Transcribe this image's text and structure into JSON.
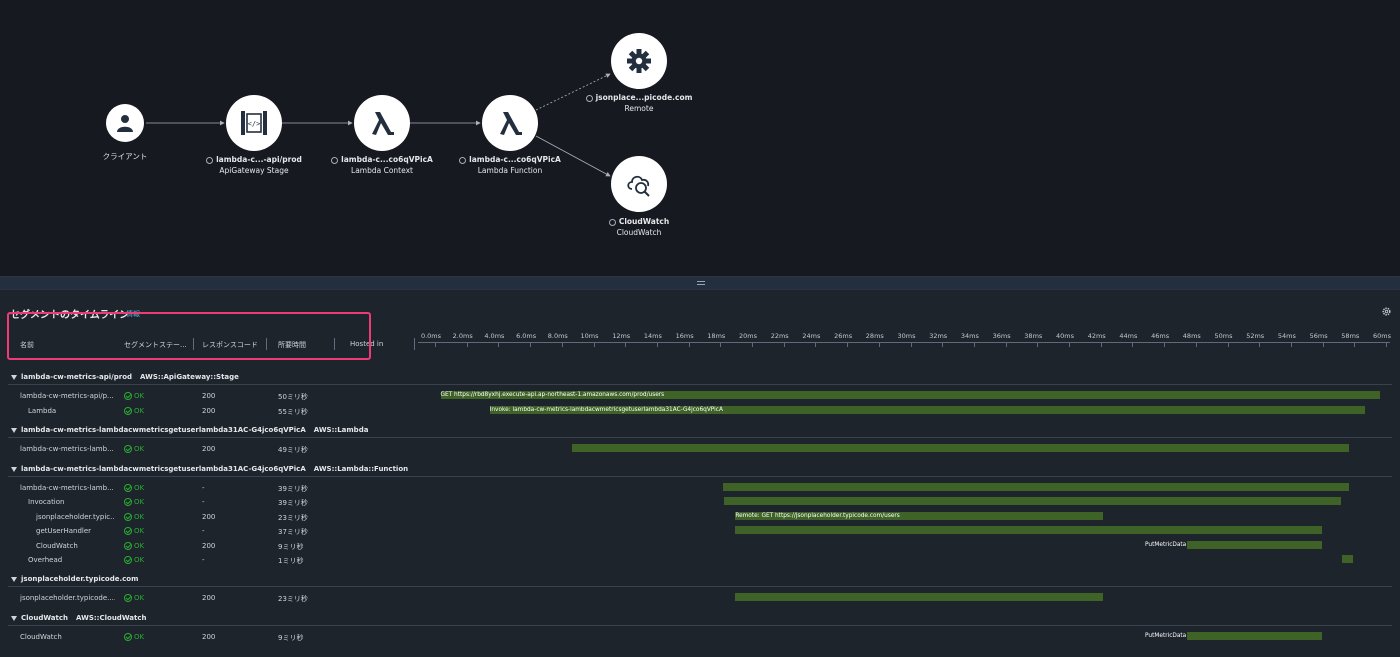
{
  "service_map": {
    "nodes": [
      {
        "id": "client",
        "name": "クライアント",
        "type": "",
        "icon": "user-icon"
      },
      {
        "id": "apigw",
        "name": "lambda-c...-api/prod",
        "type": "ApiGateway Stage",
        "icon": "api-gateway-icon"
      },
      {
        "id": "lctx",
        "name": "lambda-c...co6qVPicA",
        "type": "Lambda Context",
        "icon": "lambda-icon"
      },
      {
        "id": "lfn",
        "name": "lambda-c...co6qVPicA",
        "type": "Lambda Function",
        "icon": "lambda-icon"
      },
      {
        "id": "remote",
        "name": "jsonplace...picode.com",
        "type": "Remote",
        "icon": "gear-icon"
      },
      {
        "id": "cw",
        "name": "CloudWatch",
        "type": "CloudWatch",
        "icon": "cloudwatch-icon"
      }
    ]
  },
  "timeline": {
    "title": "セグメントのタイムライン",
    "info_link": "情報",
    "columns": [
      "名前",
      "セグメントステー...",
      "レスポンスコード",
      "所要時間",
      "Hosted in"
    ],
    "ticks": [
      "0.0ms",
      "2.0ms",
      "4.0ms",
      "6.0ms",
      "8.0ms",
      "10ms",
      "12ms",
      "14ms",
      "16ms",
      "18ms",
      "20ms",
      "22ms",
      "24ms",
      "26ms",
      "28ms",
      "30ms",
      "32ms",
      "34ms",
      "36ms",
      "38ms",
      "40ms",
      "42ms",
      "44ms",
      "46ms",
      "48ms",
      "50ms",
      "52ms",
      "54ms",
      "56ms",
      "58ms",
      "60ms"
    ],
    "groups": [
      {
        "name": "lambda-cw-metrics-api/prod",
        "type": "AWS::ApiGateway::Stage",
        "highlighted": false,
        "rows": [
          {
            "name": "lambda-cw-metrics-api/p...",
            "indent": 0,
            "status": "OK",
            "code": "200",
            "duration": "50ミリ秒",
            "start_ms": 0.6,
            "end_ms": 59.9,
            "label": "GET https://rbd8yxhj.execute-api.ap-northeast-1.amazonaws.com/prod/users"
          },
          {
            "name": "Lambda",
            "indent": 1,
            "status": "OK",
            "code": "200",
            "duration": "55ミリ秒",
            "start_ms": 3.7,
            "end_ms": 58.9,
            "label": "Invoke: lambda-cw-metrics-lambdacwmetricsgetuserlambda31AC-G4jco6qVPicA"
          }
        ]
      },
      {
        "name": "lambda-cw-metrics-lambdacwmetricsgetuserlambda31AC-G4jco6qVPicA",
        "type": "AWS::Lambda",
        "highlighted": false,
        "rows": [
          {
            "name": "lambda-cw-metrics-lamb...",
            "indent": 0,
            "status": "OK",
            "code": "200",
            "duration": "49ミリ秒",
            "start_ms": 8.9,
            "end_ms": 57.9,
            "label": ""
          }
        ]
      },
      {
        "name": "lambda-cw-metrics-lambdacwmetricsgetuserlambda31AC-G4jco6qVPicA",
        "type": "AWS::Lambda::Function",
        "highlighted": false,
        "rows": [
          {
            "name": "lambda-cw-metrics-lamb...",
            "indent": 0,
            "status": "OK",
            "code": "-",
            "duration": "39ミリ秒",
            "start_ms": 18.4,
            "end_ms": 57.9,
            "label": ""
          },
          {
            "name": "Invocation",
            "indent": 1,
            "status": "OK",
            "code": "-",
            "duration": "39ミリ秒",
            "start_ms": 18.5,
            "end_ms": 57.4,
            "label": ""
          },
          {
            "name": "jsonplaceholder.typic...",
            "indent": 2,
            "status": "OK",
            "code": "200",
            "duration": "23ミリ秒",
            "start_ms": 19.2,
            "end_ms": 42.4,
            "label": "Remote: GET https://jsonplaceholder.typicode.com/users"
          },
          {
            "name": "getUserHandler",
            "indent": 2,
            "status": "OK",
            "code": "-",
            "duration": "37ミリ秒",
            "start_ms": 19.2,
            "end_ms": 56.2,
            "label": ""
          },
          {
            "name": "CloudWatch",
            "indent": 2,
            "status": "OK",
            "code": "200",
            "duration": "9ミリ秒",
            "start_ms": 47.7,
            "end_ms": 56.2,
            "label": "PutMetricData"
          },
          {
            "name": "Overhead",
            "indent": 1,
            "status": "OK",
            "code": "-",
            "duration": "1ミリ秒",
            "start_ms": 57.5,
            "end_ms": 58.2,
            "label": ""
          }
        ]
      },
      {
        "name": "jsonplaceholder.typicode.com",
        "type": "",
        "highlighted": false,
        "rows": [
          {
            "name": "jsonplaceholder.typicode....",
            "indent": 0,
            "status": "OK",
            "code": "200",
            "duration": "23ミリ秒",
            "start_ms": 19.2,
            "end_ms": 42.4,
            "label": ""
          }
        ]
      },
      {
        "name": "CloudWatch",
        "type": "AWS::CloudWatch",
        "highlighted": true,
        "rows": [
          {
            "name": "CloudWatch",
            "indent": 0,
            "status": "OK",
            "code": "200",
            "duration": "9ミリ秒",
            "start_ms": 47.7,
            "end_ms": 56.2,
            "label": "PutMetricData"
          }
        ]
      }
    ]
  }
}
